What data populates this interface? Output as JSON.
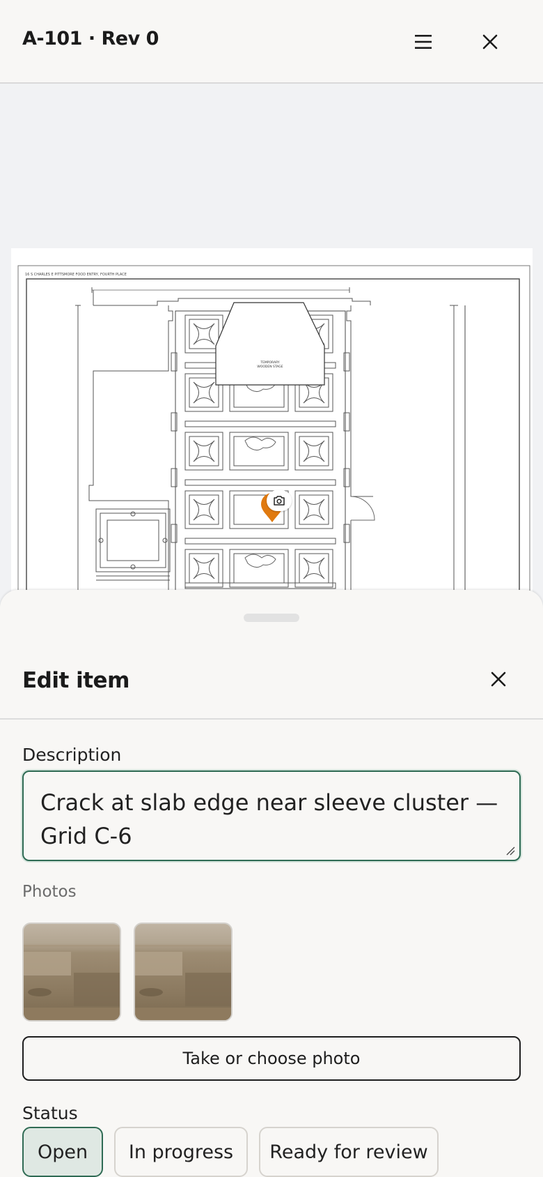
{
  "header": {
    "title": "A-101 · Rev 0",
    "menu_icon": "hamburger-menu-icon",
    "close_icon": "close-icon"
  },
  "drawing": {
    "caption": "16 S CHARLES E PITTSMORE FOOD ENTRY, FOURTH PLACE",
    "stage_label_1": "TEMPORARY",
    "stage_label_2": "WOODEN STAGE",
    "pin_color": "#e07a10",
    "marker_icon": "camera-icon"
  },
  "sheet": {
    "title": "Edit item",
    "close_icon": "close-icon",
    "description_label": "Description",
    "description_value": "Crack at slab edge near sleeve cluster — Grid C-6",
    "photos_label": "Photos",
    "photo_button_label": "Take or choose photo",
    "status_label": "Status",
    "status_options": [
      "Open",
      "In progress",
      "Ready for review"
    ],
    "status_selected": "Open"
  },
  "colors": {
    "accent": "#2f6b54",
    "accent_soft": "#dfe8e3",
    "pin": "#e07a10"
  }
}
